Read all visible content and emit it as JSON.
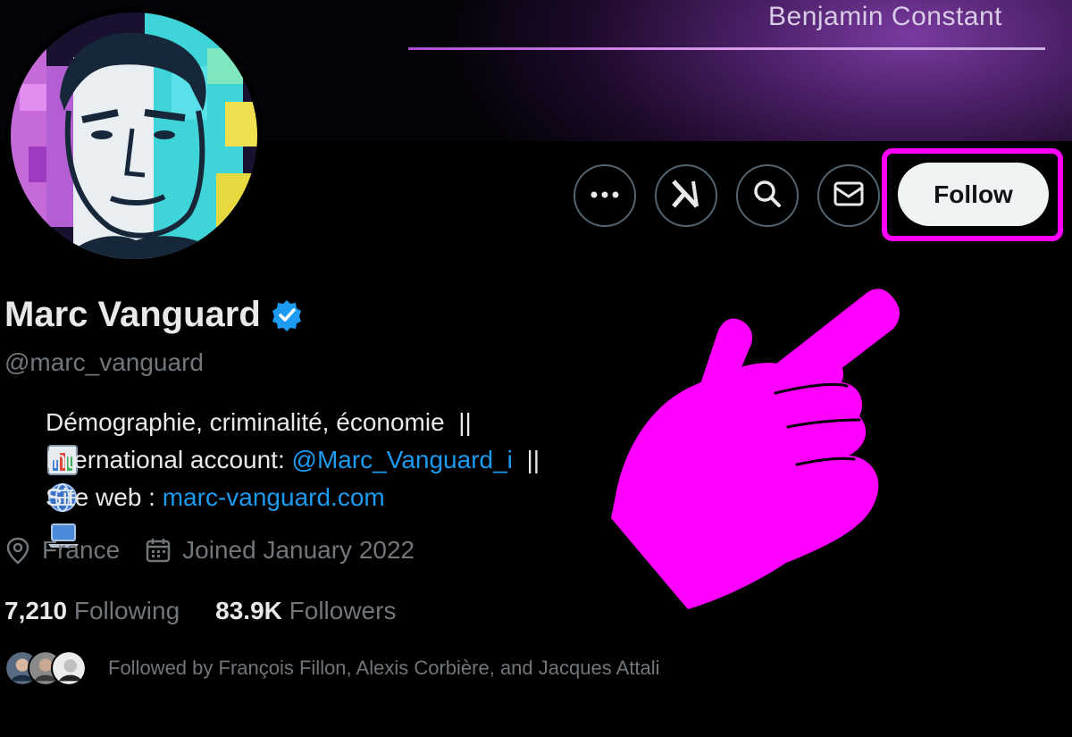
{
  "banner": {
    "quote_author": "Benjamin Constant"
  },
  "profile": {
    "name": "Marc Vanguard",
    "handle": "@marc_vanguard",
    "verified_color": "#1d9bf0",
    "bio": {
      "line1_text": "Démographie, criminalité, économie  ||",
      "line2_prefix": "International account: ",
      "line2_link": "@Marc_Vanguard_i",
      "line2_suffix": "  ||",
      "line3_prefix": "Site web : ",
      "line3_link": "marc-vanguard.com"
    },
    "location": "France",
    "joined": "Joined January 2022",
    "following_count": "7,210",
    "following_label": "Following",
    "followers_count": "83.9K",
    "followers_label": "Followers",
    "followed_by": "Followed by François Fillon, Alexis Corbière, and Jacques Attali"
  },
  "actions": {
    "more_icon": "more-icon",
    "grok_icon": "grok-icon",
    "search_icon": "search-icon",
    "message_icon": "mail-icon",
    "follow_label": "Follow"
  },
  "colors": {
    "highlight": "#ff00ff",
    "link": "#1d9bf0",
    "muted": "#71767b"
  }
}
